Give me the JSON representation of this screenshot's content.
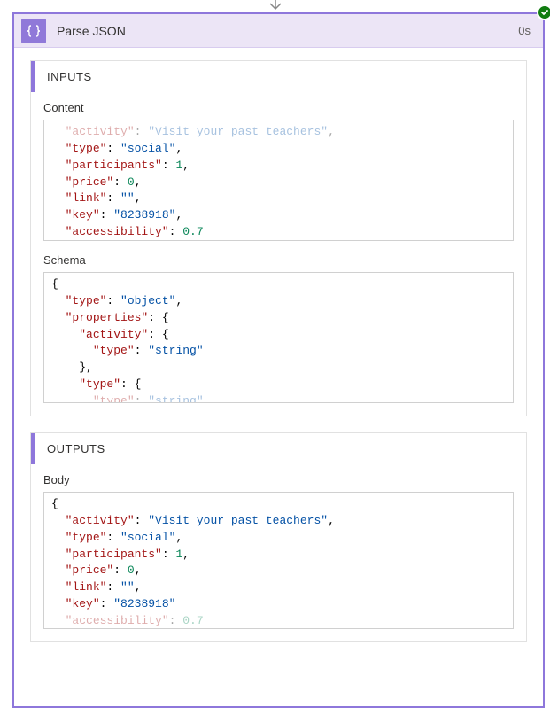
{
  "header": {
    "title": "Parse JSON",
    "duration": "0s"
  },
  "inputs": {
    "section_label": "INPUTS",
    "content_label": "Content",
    "schema_label": "Schema",
    "content_json": {
      "activity": "Visit your past teachers",
      "type": "social",
      "participants": 1,
      "price": 0,
      "link": "",
      "key": "8238918",
      "accessibility": 0.7
    },
    "schema_json": {
      "type": "object",
      "properties": {
        "activity": {
          "type": "string"
        },
        "type": {
          "type": "string"
        }
      }
    }
  },
  "outputs": {
    "section_label": "OUTPUTS",
    "body_label": "Body",
    "body_json": {
      "activity": "Visit your past teachers",
      "type": "social",
      "participants": 1,
      "price": 0,
      "link": "",
      "key": "8238918",
      "accessibility": 0.7
    }
  }
}
